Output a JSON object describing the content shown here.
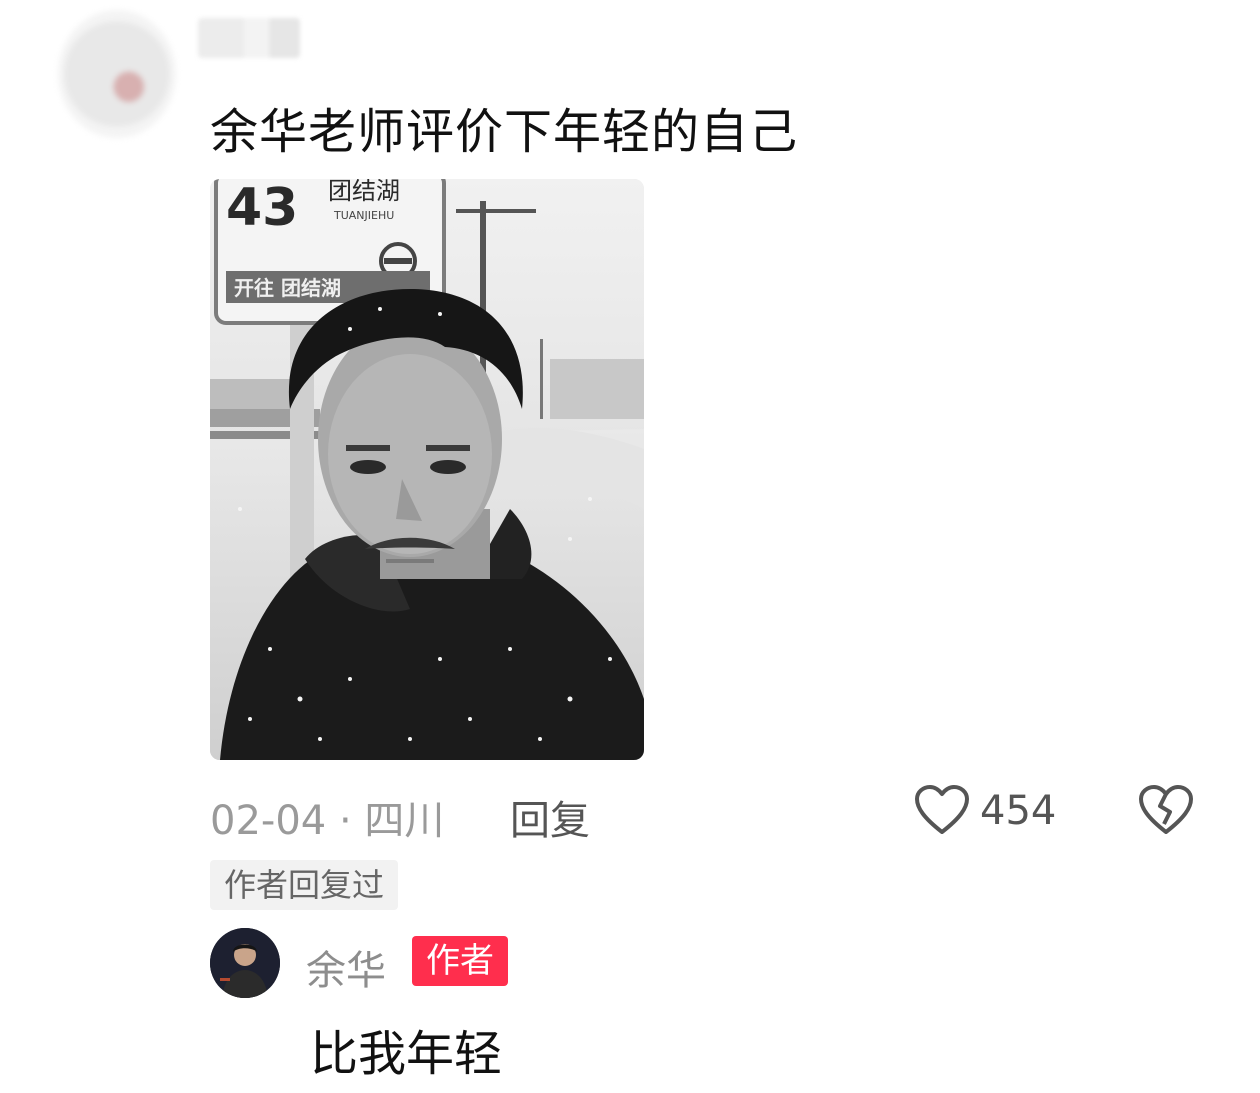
{
  "comment": {
    "text": "余华老师评价下年轻的自己",
    "image": {
      "sign_number": "43",
      "sign_station": "团结湖",
      "sign_pinyin": "TUANJIEHU",
      "sign_direction": "开往 团结湖"
    },
    "date": "02-04",
    "separator": "·",
    "location": "四川",
    "reply_label": "回复",
    "like_count": "454",
    "author_replied_tag": "作者回复过"
  },
  "reply": {
    "author_name": "余华",
    "author_badge": "作者",
    "text": "比我年轻"
  },
  "colors": {
    "badge_red": "#ff2e4d",
    "meta_gray": "#9a9a9a",
    "text_dark": "#111111"
  },
  "icons": {
    "like": "heart-outline-icon",
    "dislike": "broken-heart-icon"
  }
}
